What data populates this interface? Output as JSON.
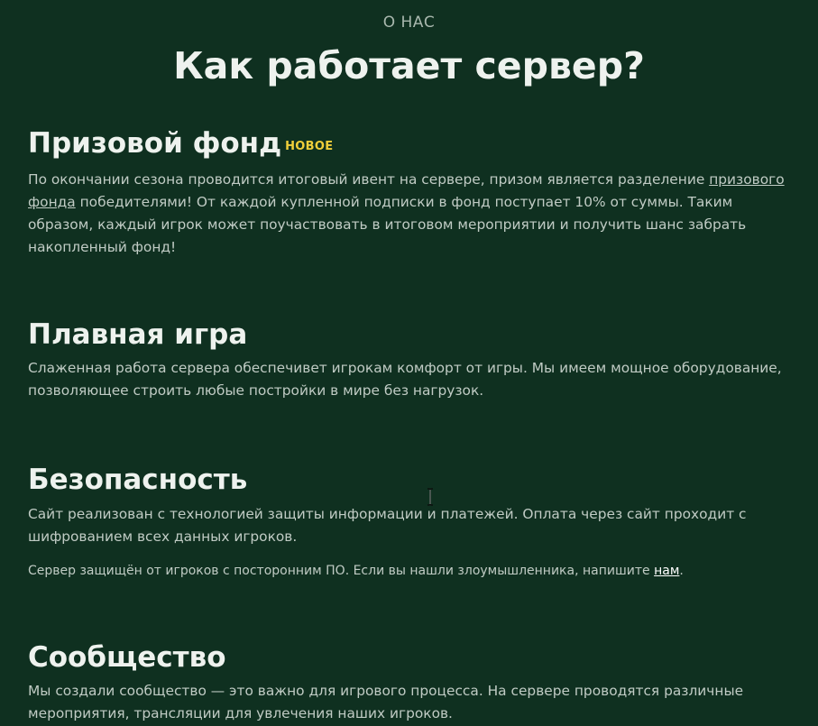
{
  "header": {
    "eyebrow": "О НАС",
    "title": "Как работает сервер?"
  },
  "sections": [
    {
      "title": "Призовой фонд",
      "badge": "НОВОЕ",
      "paragraph_before_link": "По окончании сезона проводится итоговый ивент на сервере, призом является разделение ",
      "link": "призового фонда",
      "paragraph_after_link": " победителями! От каждой купленной подписки в фонд поступает 10% от суммы. Таким образом, каждый игрок может поучаствовать в итоговом мероприятии и получить шанс забрать накопленный фонд!"
    },
    {
      "title": "Плавная игра",
      "paragraph": "Слаженная работа сервера обеспечивет игрокам комфорт от игры. Мы имеем мощное оборудование, позволяющее строить любые постройки в мире без нагрузок."
    },
    {
      "title": "Безопасность",
      "paragraph": "Сайт реализован с технологией защиты информации и платежей. Оплата через сайт проходит с шифрованием всех данных игроков.",
      "note_before_link": "Сервер защищён от игроков с посторонним ПО. Если вы нашли злоумышленника, напишите ",
      "note_link": "нам",
      "note_after_link": "."
    },
    {
      "title": "Сообщество",
      "paragraph": "Мы создали сообщество — это важно для игрового процесса. На сервере проводятся различные мероприятия, трансляции для увлечения наших игроков."
    }
  ],
  "colors": {
    "background": "#0f3020",
    "heading": "#eef2ee",
    "body_text": "#c0cbc4",
    "badge": "#f0cf3a"
  }
}
